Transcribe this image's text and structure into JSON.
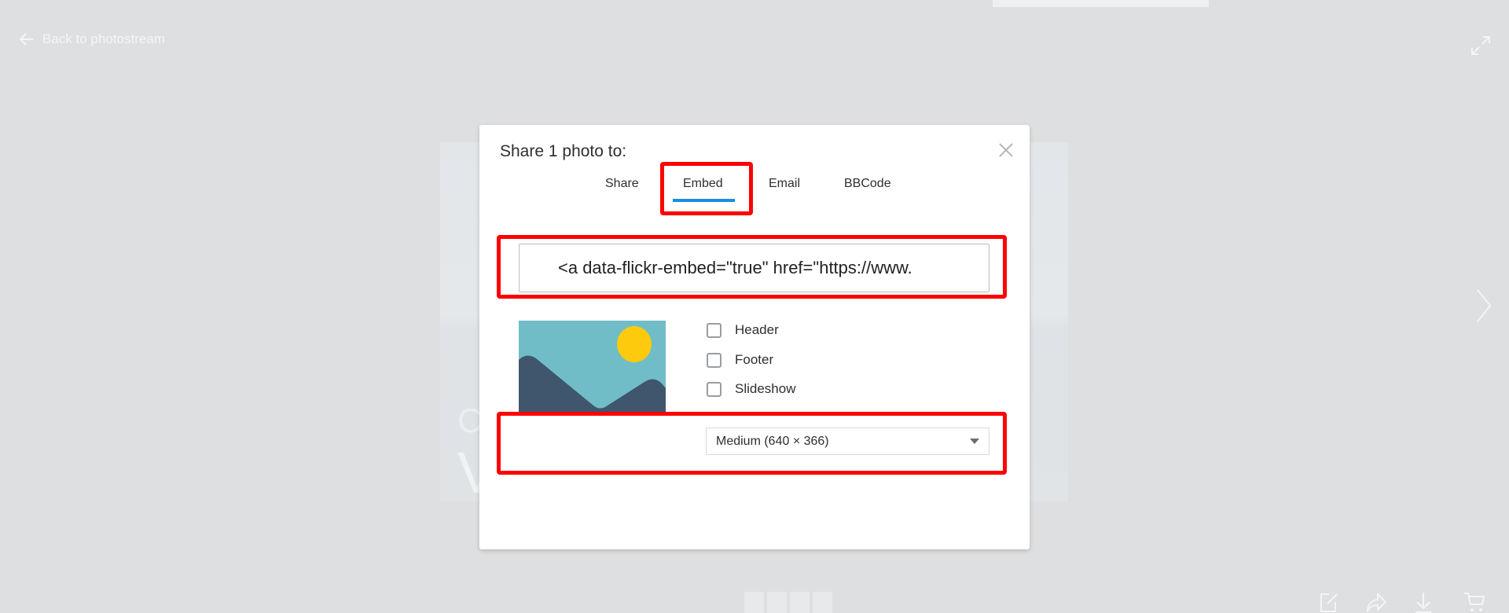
{
  "nav": {
    "back_label": "Back to photostream"
  },
  "background_photo": {
    "text_line1": "Co",
    "text_line2": "V"
  },
  "dialog": {
    "title": "Share 1 photo to:",
    "tabs": [
      {
        "label": "Share"
      },
      {
        "label": "Embed",
        "active": true
      },
      {
        "label": "Email"
      },
      {
        "label": "BBCode"
      }
    ],
    "embed_code": "<a data-flickr-embed=\"true\" href=\"https://www.",
    "options": [
      {
        "label": "Header",
        "checked": false
      },
      {
        "label": "Footer",
        "checked": false
      },
      {
        "label": "Slideshow",
        "checked": false
      }
    ],
    "size_select": "Medium (640 × 366)"
  },
  "colors": {
    "accent": "#1a8fdc",
    "highlight": "#ff0000",
    "overlay_bg": "#dedfe1"
  },
  "toolbar_icons": [
    "edit-icon",
    "share-icon",
    "download-icon",
    "cart-icon"
  ]
}
